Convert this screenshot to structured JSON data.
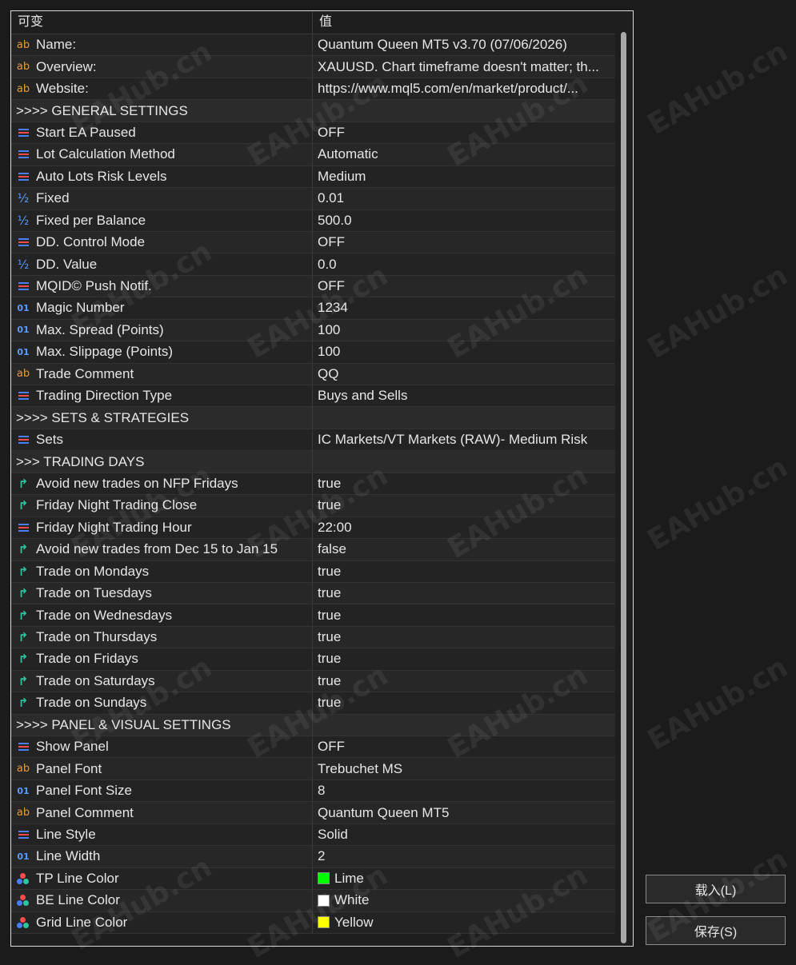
{
  "header": {
    "col_variable": "可变",
    "col_value": "值"
  },
  "rows": [
    {
      "icon": "ab",
      "name": "Name:",
      "value": "Quantum Queen MT5 v3.70 (07/06/2026)"
    },
    {
      "icon": "ab",
      "name": "Overview:",
      "value": "XAUUSD. Chart timeframe doesn't matter; th..."
    },
    {
      "icon": "ab",
      "name": "Website:",
      "value": "https://www.mql5.com/en/market/product/..."
    },
    {
      "icon": "",
      "name": ">>>> GENERAL SETTINGS",
      "value": "",
      "section": true
    },
    {
      "icon": "enum",
      "name": "Start EA Paused",
      "value": "OFF"
    },
    {
      "icon": "enum",
      "name": "Lot Calculation Method",
      "value": "Automatic"
    },
    {
      "icon": "enum",
      "name": "Auto Lots Risk Levels",
      "value": "Medium"
    },
    {
      "icon": "half",
      "name": "Fixed",
      "value": "0.01"
    },
    {
      "icon": "half",
      "name": "Fixed per Balance",
      "value": "500.0"
    },
    {
      "icon": "enum",
      "name": "DD. Control Mode",
      "value": "OFF"
    },
    {
      "icon": "half",
      "name": "DD. Value",
      "value": "0.0"
    },
    {
      "icon": "enum",
      "name": "MQID© Push Notif.",
      "value": "OFF"
    },
    {
      "icon": "num",
      "name": "Magic Number",
      "value": "1234"
    },
    {
      "icon": "num",
      "name": "Max. Spread (Points)",
      "value": "100"
    },
    {
      "icon": "num",
      "name": "Max. Slippage (Points)",
      "value": "100"
    },
    {
      "icon": "ab",
      "name": "Trade Comment",
      "value": "QQ"
    },
    {
      "icon": "enum",
      "name": "Trading Direction Type",
      "value": "Buys and Sells"
    },
    {
      "icon": "",
      "name": ">>>> SETS & STRATEGIES",
      "value": "",
      "section": true
    },
    {
      "icon": "enum",
      "name": "Sets",
      "value": "IC Markets/VT Markets (RAW)- Medium Risk"
    },
    {
      "icon": "",
      "name": ">>> TRADING DAYS",
      "value": "",
      "section": true
    },
    {
      "icon": "flow",
      "name": "Avoid new trades on NFP Fridays",
      "value": "true"
    },
    {
      "icon": "flow",
      "name": "Friday Night Trading Close",
      "value": "true"
    },
    {
      "icon": "enum",
      "name": "Friday Night Trading Hour",
      "value": "22:00"
    },
    {
      "icon": "flow",
      "name": "Avoid new trades from Dec 15 to Jan 15",
      "value": "false"
    },
    {
      "icon": "flow",
      "name": "Trade on Mondays",
      "value": "true"
    },
    {
      "icon": "flow",
      "name": "Trade on Tuesdays",
      "value": "true"
    },
    {
      "icon": "flow",
      "name": "Trade on Wednesdays",
      "value": "true"
    },
    {
      "icon": "flow",
      "name": "Trade on Thursdays",
      "value": "true"
    },
    {
      "icon": "flow",
      "name": "Trade on Fridays",
      "value": "true"
    },
    {
      "icon": "flow",
      "name": "Trade on Saturdays",
      "value": "true"
    },
    {
      "icon": "flow",
      "name": "Trade on Sundays",
      "value": "true"
    },
    {
      "icon": "",
      "name": ">>>> PANEL & VISUAL SETTINGS",
      "value": "",
      "section": true
    },
    {
      "icon": "enum",
      "name": "Show Panel",
      "value": "OFF"
    },
    {
      "icon": "ab",
      "name": "Panel Font",
      "value": "Trebuchet MS"
    },
    {
      "icon": "num",
      "name": "Panel Font Size",
      "value": "8"
    },
    {
      "icon": "ab",
      "name": "Panel Comment",
      "value": "Quantum Queen MT5"
    },
    {
      "icon": "enum",
      "name": "Line Style",
      "value": "Solid"
    },
    {
      "icon": "num",
      "name": "Line Width",
      "value": "2"
    },
    {
      "icon": "color",
      "name": "TP Line Color",
      "value": "Lime",
      "swatch": "#00ff00"
    },
    {
      "icon": "color",
      "name": "BE Line Color",
      "value": "White",
      "swatch": "#ffffff"
    },
    {
      "icon": "color",
      "name": "Grid Line Color",
      "value": "Yellow",
      "swatch": "#ffff00"
    }
  ],
  "buttons": {
    "load": "载入(L)",
    "save": "保存(S)"
  },
  "watermark": "EAHub.cn",
  "colors": {
    "ab_icon": "#e69a3a",
    "num_icon": "#5b9bff",
    "flow_icon": "#29c6a0"
  }
}
